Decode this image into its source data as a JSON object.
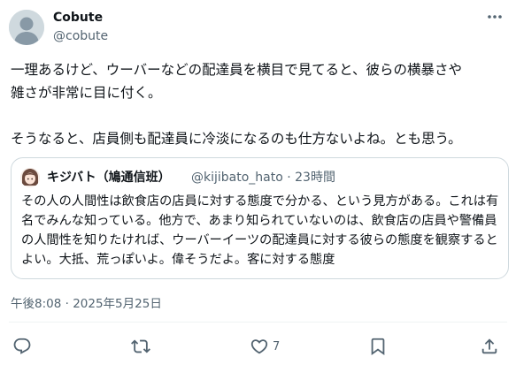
{
  "author": {
    "name": "Cobute",
    "handle": "@cobute"
  },
  "tweet": {
    "text": "一理あるけど、ウーバーなどの配達員を横目で見てると、彼らの横暴さや\n雑さが非常に目に付く。\n\nそうなると、店員側も配達員に冷淡になるのも仕方ないよね。とも思う。"
  },
  "quote": {
    "name": "キジバト（鳩通信班）",
    "handle": "@kijibato_hato · 23時間",
    "text": "その人の人間性は飲食店の店員に対する態度で分かる、という見方がある。これは有名でみんな知っている。他方で、あまり知られていないのは、飲食店の店員や警備員の人間性を知りたければ、ウーバーイーツの配達員に対する彼らの態度を観察するとよい。大抵、荒っぽいよ。偉そうだよ。客に対する態度"
  },
  "timestamp": "午後8:08 · 2025年5月25日",
  "actions": {
    "reply_icon": "reply-icon",
    "retweet_icon": "retweet-icon",
    "like_icon": "heart-icon",
    "like_count": "7",
    "bookmark_icon": "bookmark-icon",
    "share_icon": "share-icon",
    "icon_color": "#536471"
  },
  "colors": {
    "text": "#0f1419",
    "secondary": "#536471",
    "border": "#cfd9de"
  }
}
